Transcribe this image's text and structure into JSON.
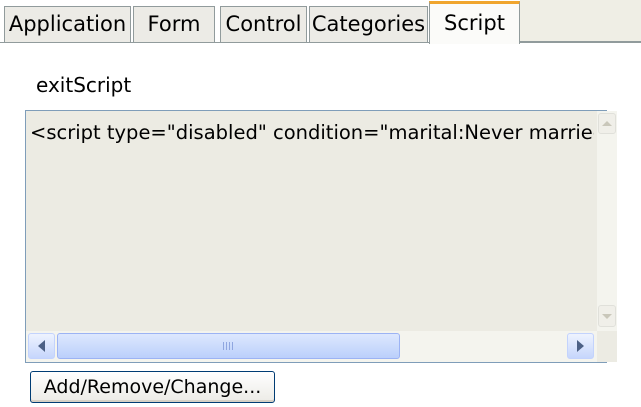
{
  "tabs": [
    {
      "label": "Application"
    },
    {
      "label": "Form"
    },
    {
      "label": "Control"
    },
    {
      "label": "Categories"
    },
    {
      "label": "Script",
      "active": true
    }
  ],
  "script_panel": {
    "field_label": "exitScript",
    "script_text": "<script type=\"disabled\" condition=\"marital:Never married an",
    "action_button": "Add/Remove/Change..."
  },
  "colors": {
    "active_tab_accent": "#f0a52e",
    "textbox_background": "#ecebe3",
    "scrollbar_thumb": "#c6d6fc"
  },
  "icons": {
    "scroll_up": "chevron-up-icon",
    "scroll_down": "chevron-down-icon",
    "scroll_left": "chevron-left-icon",
    "scroll_right": "chevron-right-icon",
    "thumb_grip": "grip-icon"
  }
}
